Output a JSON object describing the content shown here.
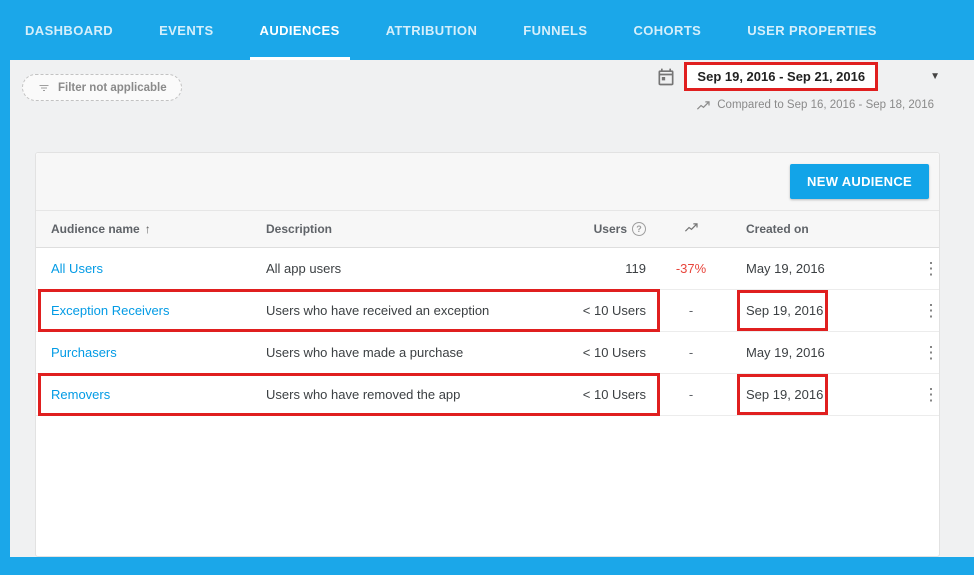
{
  "nav": {
    "items": [
      {
        "label": "DASHBOARD"
      },
      {
        "label": "EVENTS"
      },
      {
        "label": "AUDIENCES"
      },
      {
        "label": "ATTRIBUTION"
      },
      {
        "label": "FUNNELS"
      },
      {
        "label": "COHORTS"
      },
      {
        "label": "USER PROPERTIES"
      }
    ],
    "active": "AUDIENCES",
    "help_glyph": "?"
  },
  "toolbar": {
    "filter_label": "Filter not applicable",
    "date_range": "Sep 19, 2016 - Sep 21, 2016",
    "compared_label": "Compared to Sep 16, 2016 - Sep 18, 2016",
    "caret_glyph": "▼"
  },
  "audiences": {
    "new_button": "NEW AUDIENCE",
    "table": {
      "headers": {
        "name": "Audience name",
        "sort_glyph": "↑",
        "description": "Description",
        "users": "Users",
        "users_help_glyph": "?",
        "created": "Created on"
      },
      "rows": [
        {
          "name": "All Users",
          "description": "All app users",
          "users": "119",
          "change": "-37%",
          "created": "May 19, 2016",
          "annotated": false
        },
        {
          "name": "Exception Receivers",
          "description": "Users who have received an exception",
          "users": "< 10 Users",
          "change": "-",
          "created": "Sep 19, 2016",
          "annotated": true
        },
        {
          "name": "Purchasers",
          "description": "Users who have made a purchase",
          "users": "< 10 Users",
          "change": "-",
          "created": "May 19, 2016",
          "annotated": false
        },
        {
          "name": "Removers",
          "description": "Users who have removed the app",
          "users": "< 10 Users",
          "change": "-",
          "created": "Sep 19, 2016",
          "annotated": true
        }
      ],
      "kebab_glyph": "⋮"
    }
  },
  "colors": {
    "nav_blue": "#1ba7e9",
    "button_blue": "#12a4e8",
    "link_blue": "#039be5",
    "annotation_red": "#e01f1f",
    "negative_red": "#e8453c"
  }
}
